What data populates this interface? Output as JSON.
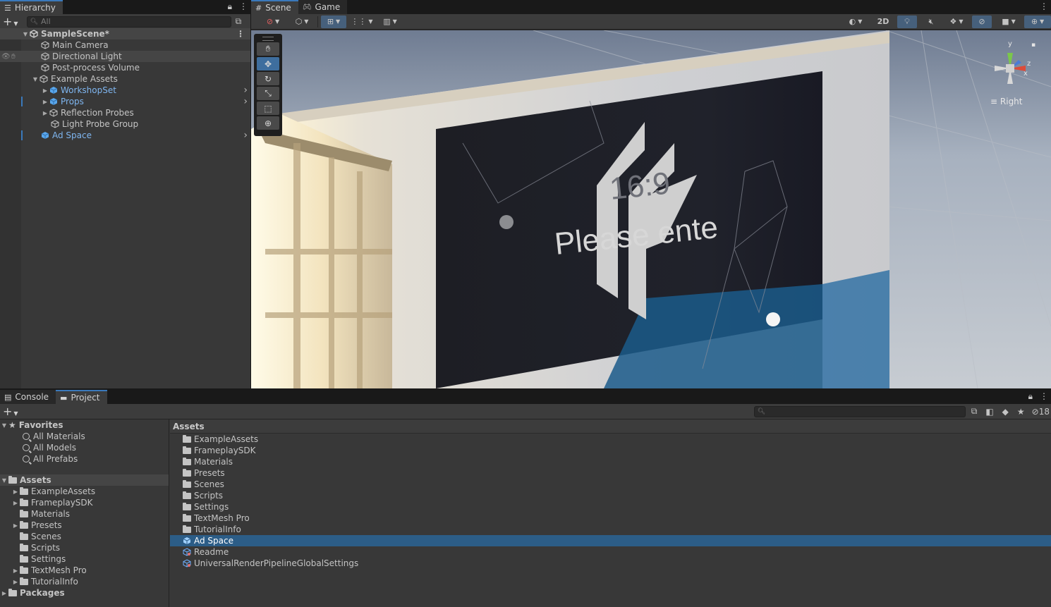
{
  "hierarchy": {
    "tab_label": "Hierarchy",
    "search_placeholder": "All",
    "scene_name": "SampleScene*",
    "items": [
      {
        "label": "Main Camera"
      },
      {
        "label": "Directional Light"
      },
      {
        "label": "Post-process Volume"
      },
      {
        "label": "Example Assets"
      },
      {
        "label": "WorkshopSet"
      },
      {
        "label": "Props"
      },
      {
        "label": "Reflection Probes"
      },
      {
        "label": "Light Probe Group"
      },
      {
        "label": "Ad Space"
      }
    ]
  },
  "scene": {
    "tabs": [
      {
        "label": "Scene"
      },
      {
        "label": "Game"
      }
    ],
    "mode_2d": "2D",
    "gizmo_label": "Right",
    "gizmo_y": "y",
    "gizmo_x": "x",
    "gizmo_z": "z",
    "billboard_text_ratio": "16:9",
    "billboard_text_main": "Please ente"
  },
  "bottom": {
    "tabs": [
      {
        "label": "Console"
      },
      {
        "label": "Project"
      }
    ],
    "hidden_count": "18",
    "favorites": {
      "label": "Favorites",
      "items": [
        {
          "label": "All Materials"
        },
        {
          "label": "All Models"
        },
        {
          "label": "All Prefabs"
        }
      ]
    },
    "assets_tree": {
      "label": "Assets",
      "items": [
        {
          "label": "ExampleAssets"
        },
        {
          "label": "FrameplaySDK"
        },
        {
          "label": "Materials"
        },
        {
          "label": "Presets"
        },
        {
          "label": "Scenes"
        },
        {
          "label": "Scripts"
        },
        {
          "label": "Settings"
        },
        {
          "label": "TextMesh Pro"
        },
        {
          "label": "TutorialInfo"
        }
      ]
    },
    "packages_label": "Packages",
    "breadcrumb": "Assets",
    "asset_list": [
      {
        "label": "ExampleAssets"
      },
      {
        "label": "FrameplaySDK"
      },
      {
        "label": "Materials"
      },
      {
        "label": "Presets"
      },
      {
        "label": "Scenes"
      },
      {
        "label": "Scripts"
      },
      {
        "label": "Settings"
      },
      {
        "label": "TextMesh Pro"
      },
      {
        "label": "TutorialInfo"
      },
      {
        "label": "Ad Space"
      },
      {
        "label": "Readme"
      },
      {
        "label": "UniversalRenderPipelineGlobalSettings"
      }
    ]
  },
  "colors": {
    "accent": "#3a79bb",
    "selection": "#2c5d87",
    "prefab_blue": "#7fb6f0",
    "panel_bg": "#383838"
  }
}
